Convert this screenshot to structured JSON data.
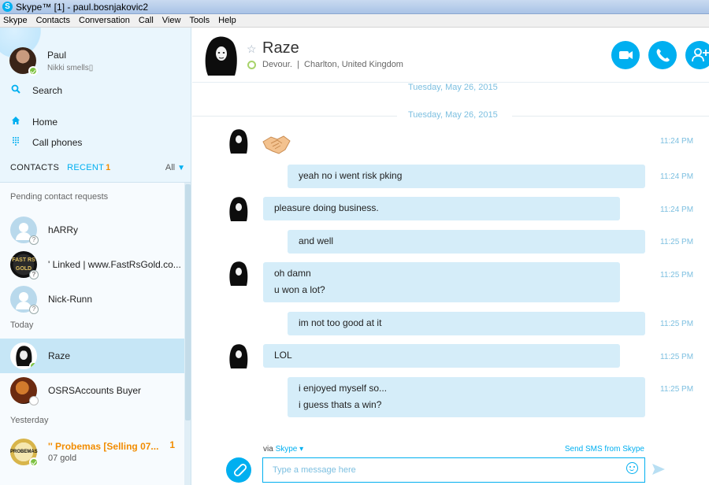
{
  "window": {
    "title": "Skype™ [1] - paul.bosnjakovic2"
  },
  "menu": [
    "Skype",
    "Contacts",
    "Conversation",
    "Call",
    "View",
    "Tools",
    "Help"
  ],
  "profile": {
    "name": "Paul",
    "mood": "Nikki smells▯"
  },
  "nav": {
    "search": "Search",
    "home": "Home",
    "call_phones": "Call phones"
  },
  "tabs": {
    "contacts": "CONTACTS",
    "recent": "RECENT",
    "recent_count": "1",
    "filter": "All"
  },
  "sections": {
    "pending": "Pending contact requests",
    "today": "Today",
    "yesterday": "Yesterday"
  },
  "pending_contacts": [
    {
      "name": "hARRy"
    },
    {
      "name": "' Linked | www.FastRsGold.co...",
      "avatar_text": "FAST RS GOLD"
    },
    {
      "name": "Nick-Runn"
    }
  ],
  "today_contacts": [
    {
      "name": "Raze",
      "active": true
    },
    {
      "name": "OSRSAccounts Buyer"
    }
  ],
  "yesterday_contacts": [
    {
      "name": "'' Probemas [Selling 07...",
      "subtitle": "07 gold",
      "count": "1",
      "avatar_text": "PROBEMAS"
    }
  ],
  "conversation": {
    "contact_name": "Raze",
    "mood": "Devour.",
    "location": "Charlton, United Kingdom",
    "dates": [
      "Tuesday, May 26, 2015",
      "Tuesday, May 26, 2015"
    ],
    "messages": [
      {
        "from": "Raze",
        "text": "handshake-emoticon",
        "time": "11:24 PM"
      },
      {
        "from": "me",
        "lines": [
          "yeah no i went risk pking"
        ],
        "time": "11:24 PM"
      },
      {
        "from": "Raze",
        "lines": [
          "pleasure doing business."
        ],
        "time": "11:24 PM"
      },
      {
        "from": "me",
        "lines": [
          "and well"
        ],
        "time": "11:25 PM"
      },
      {
        "from": "Raze",
        "lines": [
          "oh damn",
          "u won a lot?"
        ],
        "time": "11:25 PM"
      },
      {
        "from": "me",
        "lines": [
          "im not too good at it"
        ],
        "time": "11:25 PM"
      },
      {
        "from": "Raze",
        "lines": [
          "LOL"
        ],
        "time": "11:25 PM"
      },
      {
        "from": "me",
        "lines": [
          "i enjoyed myself so...",
          "i guess thats a win?"
        ],
        "time": "11:25 PM"
      }
    ]
  },
  "composer": {
    "via_prefix": "via",
    "via_service": "Skype",
    "sms_link": "Send SMS from Skype",
    "placeholder": "Type a message here"
  },
  "colors": {
    "accent": "#00aff0",
    "bubble": "#d5edf9",
    "online": "#7dc242",
    "badge": "#f28c00"
  },
  "icons": [
    "skype-icon",
    "search-icon",
    "home-icon",
    "dialpad-icon",
    "video-call-icon",
    "call-icon",
    "add-people-icon",
    "star-icon",
    "attach-icon",
    "emoji-icon",
    "send-icon",
    "handshake-icon"
  ]
}
